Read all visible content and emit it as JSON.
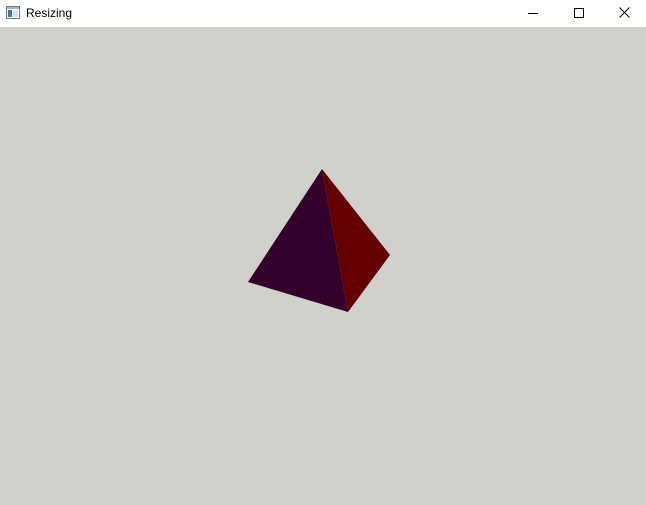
{
  "window": {
    "title": "Resizing",
    "icon": "app-window-icon",
    "controls": {
      "minimize_icon": "minimize-icon",
      "maximize_icon": "maximize-icon",
      "close_icon": "close-icon"
    }
  },
  "scene": {
    "background_color": "#d0d0cc",
    "object": "pyramid",
    "face_colors": {
      "left_face": "#32002a",
      "right_face": "#650000"
    }
  }
}
